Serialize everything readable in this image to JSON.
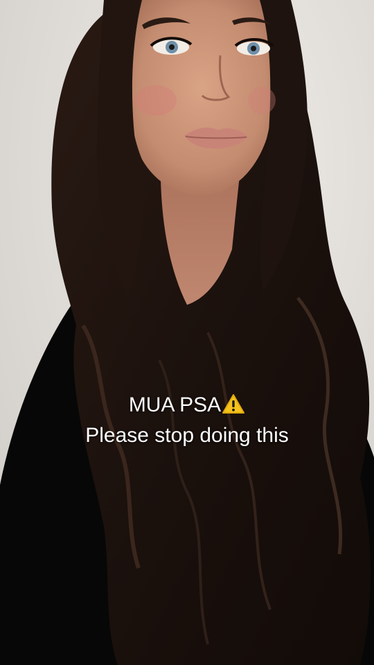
{
  "caption": {
    "line1": "MUA PSA",
    "line2": "Please stop doing this",
    "emoji_icon": "warning-icon"
  },
  "colors": {
    "background": "#e2dfdb",
    "hair": "#1b110d",
    "clothing": "#070707",
    "skin": "#c48c70",
    "caption_text": "#ffffff",
    "warning_yellow": "#f6c31c"
  }
}
